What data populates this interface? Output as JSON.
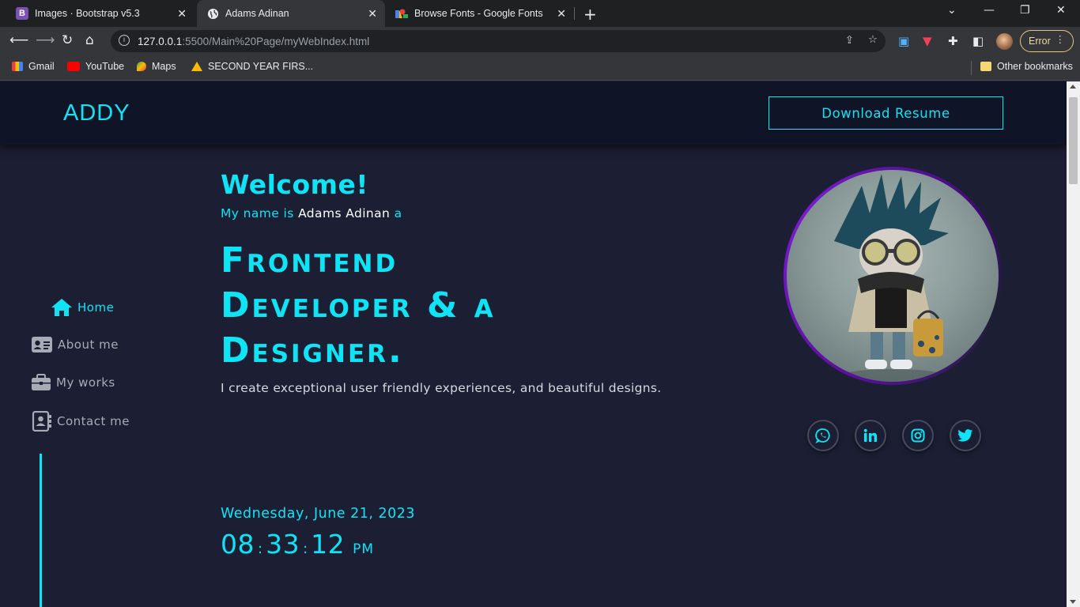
{
  "browser": {
    "tabs": [
      {
        "title": "Images · Bootstrap v5.3",
        "icon": "bootstrap-icon",
        "active": false
      },
      {
        "title": "Adams Adinan",
        "icon": "globe-icon",
        "active": true
      },
      {
        "title": "Browse Fonts - Google Fonts",
        "icon": "google-fonts-icon",
        "active": false
      }
    ],
    "url_host": "127.0.0.1",
    "url_rest": ":5500/Main%20Page/myWebIndex.html",
    "error_label": "Error",
    "bookmarks": [
      {
        "label": "Gmail",
        "icon": "gmail-icon"
      },
      {
        "label": "YouTube",
        "icon": "youtube-icon"
      },
      {
        "label": "Maps",
        "icon": "maps-icon"
      },
      {
        "label": "SECOND YEAR FIRS...",
        "icon": "drive-icon"
      }
    ],
    "other_bookmarks": "Other bookmarks"
  },
  "site": {
    "logo": "ADDY",
    "resume_button": "Download Resume",
    "nav": [
      {
        "label": "Home",
        "icon": "home-icon",
        "active": true
      },
      {
        "label": "About me",
        "icon": "id-card-icon",
        "active": false
      },
      {
        "label": "My works",
        "icon": "briefcase-icon",
        "active": false
      },
      {
        "label": "Contact me",
        "icon": "contact-book-icon",
        "active": false
      }
    ],
    "hero": {
      "welcome": "Welcome!",
      "intro_prefix": "My name is",
      "intro_name": "Adams Adinan",
      "intro_suffix": "a",
      "headline_1": "Frontend",
      "headline_2": "Developer & a",
      "headline_3": "Designer.",
      "description": "I create exceptional user friendly experiences, and beautiful designs."
    },
    "datetime": {
      "date": "Wednesday, June 21, 2023",
      "hours": "08",
      "minutes": "33",
      "seconds": "12",
      "ampm": "PM"
    },
    "socials": [
      {
        "name": "whatsapp-icon"
      },
      {
        "name": "linkedin-icon"
      },
      {
        "name": "instagram-icon"
      },
      {
        "name": "twitter-icon"
      }
    ],
    "colors": {
      "accent": "#0ee4f5",
      "background": "#1c1f33",
      "header": "#101427",
      "ring": "#7a1bd0"
    }
  }
}
